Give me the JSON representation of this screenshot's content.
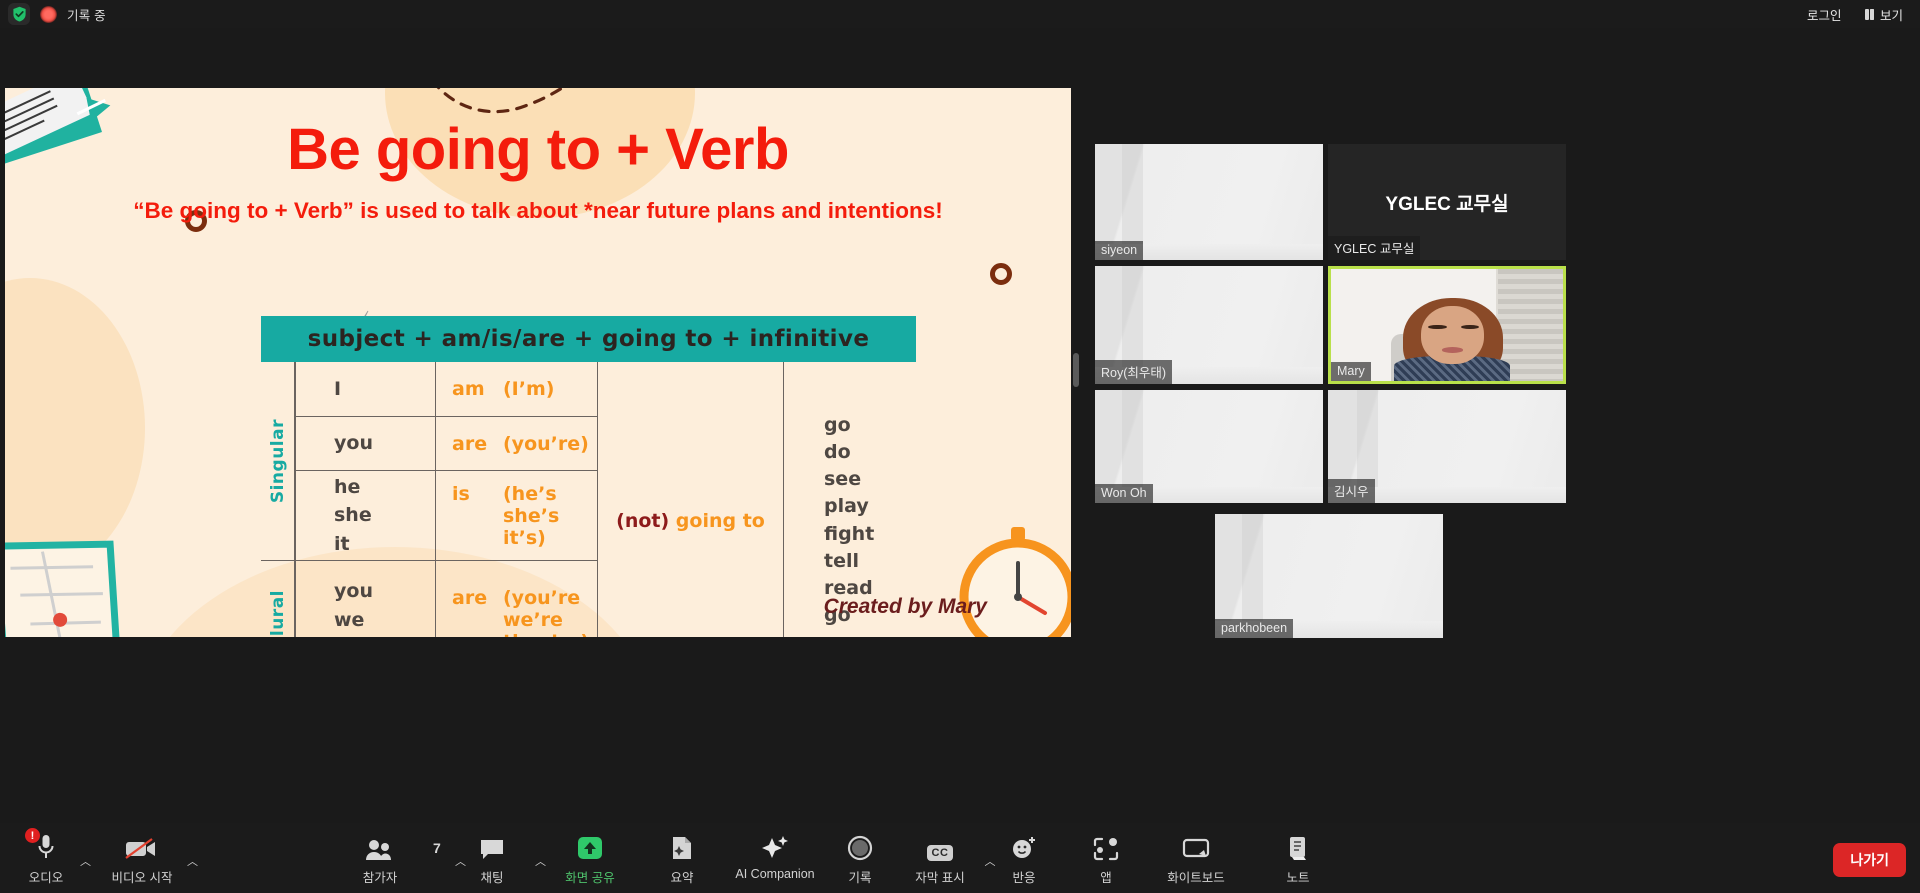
{
  "topbar": {
    "shield_icon": "shield-check-icon",
    "recording_icon": "recording-dot-icon",
    "recording_label": "기록 중",
    "login_label": "로그인",
    "view_icon": "grid-view-icon",
    "view_label": "보기"
  },
  "slide": {
    "title": "Be going to + Verb",
    "subtitle": "“Be going to + Verb” is used to talk about *near future plans and intentions!",
    "formula": "subject + am/is/are + going to + infinitive",
    "credit": "Created by Mary",
    "labels": {
      "singular": "Singular",
      "plural": "Plural"
    },
    "not_going_to": {
      "not": "(not)",
      "going_to": "going to"
    },
    "singular_rows": [
      {
        "subject": "I",
        "be": "am",
        "contraction": "(I’m)"
      },
      {
        "subject": "you",
        "be": "are",
        "contraction": "(you’re)"
      },
      {
        "subject": "he\nshe\nit",
        "be": "is",
        "contraction": "(he’s\nshe’s\nit’s)"
      }
    ],
    "plural_rows": [
      {
        "subject": "you\nwe\nthey",
        "be": "are",
        "contraction": "(you’re\nwe’re\nthey’re)"
      }
    ],
    "infinitives": [
      "go",
      "do",
      "see",
      "play",
      "fight",
      "tell",
      "read",
      "go"
    ],
    "colors": {
      "bg": "#fdeedb",
      "title_red": "#f41c0c",
      "teal": "#17aaa2",
      "orange": "#f7951e",
      "dark_red": "#8d1b1b",
      "subject_gray": "#4e4742"
    }
  },
  "gallery": {
    "tiles": [
      {
        "name": "siyeon",
        "type": "video",
        "active": false
      },
      {
        "name": "YGLEC 교무실",
        "type": "name",
        "active": false,
        "display_name": "YGLEC 교무실"
      },
      {
        "name": "Roy(최우태)",
        "type": "video",
        "active": false
      },
      {
        "name": "Mary",
        "type": "person",
        "active": true
      },
      {
        "name": "Won Oh",
        "type": "video",
        "active": false
      },
      {
        "name": "김시우",
        "type": "video",
        "active": false
      },
      {
        "name": "parkhobeen",
        "type": "video",
        "active": false
      }
    ],
    "active_speaker_color": "#b9e04a"
  },
  "toolbar": {
    "items": [
      {
        "label": "오디오",
        "icon": "microphone-muted-icon",
        "caret": true,
        "badge": "!",
        "green": false
      },
      {
        "label": "비디오 시작",
        "icon": "video-off-icon",
        "caret": true,
        "badge": null,
        "green": false
      },
      {
        "label": "참가자",
        "icon": "participants-icon",
        "caret": true,
        "count": "7",
        "green": false
      },
      {
        "label": "채팅",
        "icon": "chat-bubble-icon",
        "caret": true,
        "badge": null,
        "green": false
      },
      {
        "label": "화면 공유",
        "icon": "share-screen-icon",
        "caret": false,
        "badge": null,
        "green": true
      },
      {
        "label": "요약",
        "icon": "summary-doc-icon",
        "caret": false,
        "badge": null,
        "green": false
      },
      {
        "label": "AI Companion",
        "icon": "ai-sparkle-icon",
        "caret": false,
        "badge": null,
        "green": false
      },
      {
        "label": "기록",
        "icon": "record-circle-icon",
        "caret": false,
        "badge": null,
        "green": false
      },
      {
        "label": "자막 표시",
        "icon": "closed-caption-icon",
        "caret": true,
        "badge": null,
        "green": false
      },
      {
        "label": "반응",
        "icon": "reactions-smiley-icon",
        "caret": false,
        "badge": null,
        "green": false
      },
      {
        "label": "앱",
        "icon": "apps-icon",
        "caret": false,
        "badge": null,
        "green": false
      },
      {
        "label": "화이트보드",
        "icon": "whiteboard-icon",
        "caret": false,
        "badge": null,
        "green": false
      },
      {
        "label": "노트",
        "icon": "notes-icon",
        "caret": false,
        "badge": null,
        "green": false
      }
    ],
    "leave_label": "나가기",
    "leave_color": "#dc2626"
  }
}
